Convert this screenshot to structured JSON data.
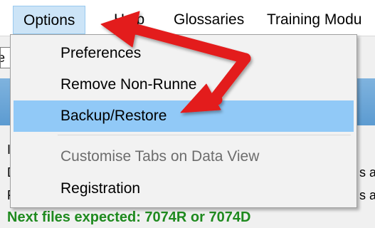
{
  "menubar": {
    "items": [
      "Options",
      "Help",
      "Glossaries",
      "Training Modu"
    ]
  },
  "background": {
    "field_text": "e",
    "left_letters": [
      "I",
      "D",
      "F"
    ],
    "right_fragments": [
      "s a",
      "s a"
    ],
    "status_text": "Next files expected: 7074R or 7074D"
  },
  "dropdown": {
    "items": [
      {
        "label": "Preferences",
        "state": "normal"
      },
      {
        "label": "Remove Non-Runne",
        "state": "normal"
      },
      {
        "label": "Backup/Restore",
        "state": "highlighted"
      },
      {
        "label": "Customise Tabs on Data View",
        "state": "disabled"
      },
      {
        "label": "Registration",
        "state": "normal"
      }
    ]
  },
  "colors": {
    "highlight": "#91c9f7",
    "arrow": "#e31b1b",
    "status_green": "#1f8a1f"
  },
  "icons": {
    "annotation": "red-arrow-icon"
  }
}
